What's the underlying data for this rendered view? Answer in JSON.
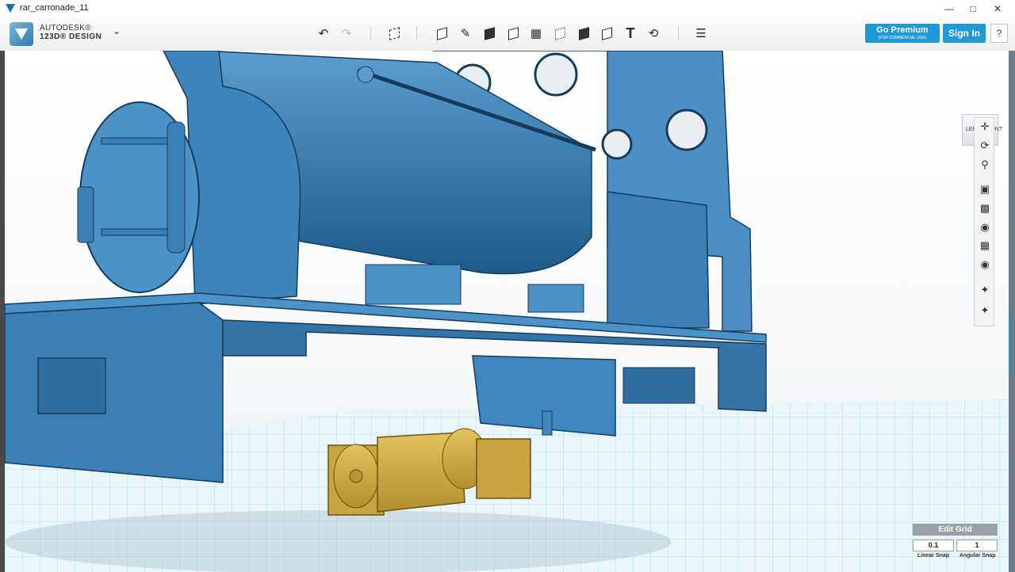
{
  "window": {
    "title": "rar_carronade_11",
    "controls": [
      "minimize-icon",
      "maximize-icon",
      "close-icon"
    ]
  },
  "brand": {
    "line1": "AUTODESK®",
    "line2": "123D® DESIGN"
  },
  "toolbar": {
    "undo_icon": "undo-icon",
    "redo_icon": "redo-icon",
    "tools": [
      "transform",
      "primitives",
      "sketch",
      "construct",
      "modify",
      "pattern",
      "grouping",
      "combine",
      "measure",
      "text",
      "snap",
      "material"
    ],
    "text_tool_label": "T"
  },
  "account": {
    "premium_label": "Go Premium",
    "premium_sub": "(FOR COMMERCIAL USE)",
    "signin_label": "Sign In",
    "help_label": "?"
  },
  "viewcube": {
    "left": "LEFT",
    "front": "FRONT"
  },
  "navbar": {
    "items": [
      "pan",
      "orbit",
      "zoom",
      "fit",
      "view-perspective",
      "visibility",
      "materials-outlines",
      "screenshot",
      "selection-filter",
      "material-edit"
    ]
  },
  "grid": {
    "edit_label": "Edit Grid",
    "linear_snap_value": "0.1",
    "linear_snap_label": "Linear Snap",
    "angular_snap_value": "1",
    "angular_snap_label": "Angular Snap"
  },
  "colors": {
    "model_blue": "#3f86bf",
    "motor_gold": "#d4b24a",
    "accent": "#1e9ad6",
    "grid_line": "#9fd4e2"
  }
}
